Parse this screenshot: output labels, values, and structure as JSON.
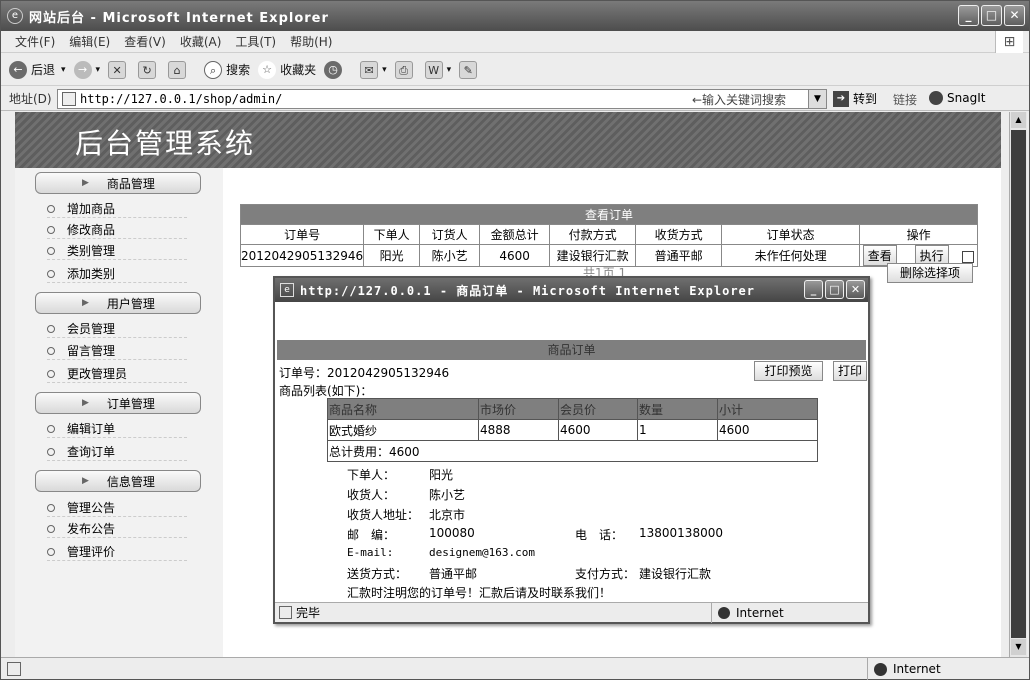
{
  "window": {
    "title": "网站后台 - Microsoft Internet Explorer",
    "controls": [
      "_",
      "□",
      "✕"
    ]
  },
  "menu": [
    "文件(F)",
    "编辑(E)",
    "查看(V)",
    "收藏(A)",
    "工具(T)",
    "帮助(H)"
  ],
  "toolbar": {
    "back": "后退",
    "search": "搜索",
    "favorites": "收藏夹"
  },
  "address": {
    "label": "地址(D)",
    "url": "http://127.0.0.1/shop/admin/",
    "keyword_hint": "←输入关键词搜索",
    "go": "转到",
    "links": "链接",
    "snagit": "SnagIt"
  },
  "banner": {
    "title": "后台管理系统"
  },
  "sidebar": {
    "sections": [
      {
        "title": "商品管理",
        "items": [
          "增加商品",
          "修改商品",
          "类别管理",
          "添加类别"
        ]
      },
      {
        "title": "用户管理",
        "items": [
          "会员管理",
          "留言管理",
          "更改管理员"
        ]
      },
      {
        "title": "订单管理",
        "items": [
          "编辑订单",
          "查询订单"
        ]
      },
      {
        "title": "信息管理",
        "items": [
          "管理公告",
          "发布公告",
          "管理评价"
        ]
      }
    ]
  },
  "orders": {
    "caption": "查看订单",
    "headers": [
      "订单号",
      "下单人",
      "订货人",
      "金额总计",
      "付款方式",
      "收货方式",
      "订单状态",
      "操作"
    ],
    "rows": [
      {
        "id": "2012042905132946",
        "buyer": "阳光",
        "receiver": "陈小艺",
        "total": "4600",
        "pay": "建设银行汇款",
        "ship": "普通平邮",
        "status": "未作任何处理",
        "view": "查看",
        "exec": "执行"
      }
    ],
    "pager_partial": "共1页  1",
    "delete_selected": "删除选择项"
  },
  "popup": {
    "title": "http://127.0.0.1 - 商品订单 - Microsoft Internet Explorer",
    "header": "商品订单",
    "order_no_label": "订单号：",
    "order_no": "2012042905132946",
    "preview": "打印预览",
    "print": "打印",
    "list_label": "商品列表(如下)：",
    "goods_headers": [
      "商品名称",
      "市场价",
      "会员价",
      "数量",
      "小计"
    ],
    "goods_rows": [
      [
        "欧式婚纱",
        "4888",
        "4600",
        "1",
        "4600"
      ]
    ],
    "total_label": "总计费用：4600",
    "buyer_label": "下单人：",
    "buyer": "阳光",
    "receiver_label": "收货人：",
    "receiver": "陈小艺",
    "addr_label": "收货人地址：",
    "addr": "北京市",
    "zip_label": "邮　编：",
    "zip": "100080",
    "phone_label": "电　话：",
    "phone": "13800138000",
    "email_label": "E-mail:",
    "email": "designem@163.com",
    "ship_label": "送货方式：",
    "ship": "普通平邮",
    "pay_label": "支付方式：",
    "pay": "建设银行汇款",
    "notice": "汇款时注明您的订单号！汇款后请及时联系我们！",
    "status": "完毕",
    "zone": "Internet"
  },
  "status": {
    "zone": "Internet"
  }
}
